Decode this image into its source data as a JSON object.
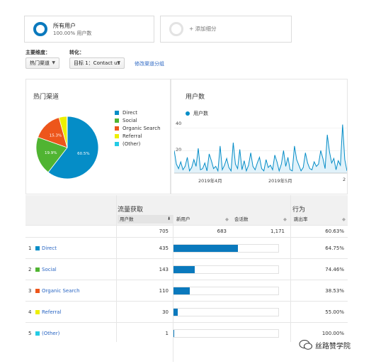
{
  "segments": {
    "active": {
      "title": "所有用户",
      "subtitle": "100.00% 用户数"
    },
    "add": {
      "label": "+ 添加细分"
    }
  },
  "controls": {
    "primary_label": "主要维度：",
    "conversion_label": "转化：",
    "primary_value": "热门渠道",
    "conversion_value": "目标 1：Contact us",
    "edit_link": "修改渠道分组"
  },
  "pie_panel": {
    "title": "热门渠道",
    "legend": [
      {
        "name": "Direct",
        "color": "#058dc7"
      },
      {
        "name": "Social",
        "color": "#50b432"
      },
      {
        "name": "Organic Search",
        "color": "#ed561b"
      },
      {
        "name": "Referral",
        "color": "#edef00"
      },
      {
        "name": "(Other)",
        "color": "#24cbe5"
      }
    ]
  },
  "line_panel": {
    "title": "用户数",
    "legend": "用户数",
    "y_ticks": [
      "40",
      "20"
    ],
    "x_ticks": [
      "2019年4月",
      "2019年5月",
      "2"
    ]
  },
  "chart_data": [
    {
      "type": "pie",
      "categories": [
        "Direct",
        "Social",
        "Organic Search",
        "Referral",
        "(Other)"
      ],
      "values": [
        435,
        143,
        110,
        30,
        1
      ],
      "labels": [
        "60.5%",
        "19.9%",
        "15.3%",
        "",
        ""
      ]
    },
    {
      "type": "area",
      "series": [
        {
          "name": "用户数",
          "values": [
            20,
            8,
            4,
            10,
            3,
            6,
            14,
            2,
            5,
            12,
            6,
            22,
            3,
            4,
            9,
            2,
            17,
            11,
            4,
            6,
            2,
            24,
            3,
            7,
            13,
            5,
            2,
            27,
            8,
            4,
            21,
            3,
            11,
            2,
            7,
            18,
            6,
            3,
            9,
            14,
            4,
            2,
            12,
            5,
            7,
            3,
            16,
            10,
            2,
            8,
            20,
            6,
            14,
            3,
            2,
            24,
            12,
            7,
            2,
            5,
            18,
            9,
            4,
            3,
            10,
            6,
            8,
            20,
            13,
            4,
            34,
            19,
            9,
            13,
            3,
            11,
            7,
            43,
            12,
            2
          ]
        }
      ],
      "ylim": [
        0,
        40
      ]
    }
  ],
  "table": {
    "group_acquisition": "流量获取",
    "group_behavior": "行为",
    "columns": [
      "用户数",
      "新用户",
      "会话数",
      "跳出率"
    ],
    "totals": [
      "705",
      "683",
      "1,171",
      "60.63%"
    ],
    "rows": [
      {
        "idx": "1",
        "name": "Direct",
        "color": "#058dc7",
        "users": "435",
        "bounce": "64.75%",
        "share": 0.617
      },
      {
        "idx": "2",
        "name": "Social",
        "color": "#50b432",
        "users": "143",
        "bounce": "74.46%",
        "share": 0.203
      },
      {
        "idx": "3",
        "name": "Organic Search",
        "color": "#ed561b",
        "users": "110",
        "bounce": "38.53%",
        "share": 0.156
      },
      {
        "idx": "4",
        "name": "Referral",
        "color": "#edef00",
        "users": "30",
        "bounce": "55.00%",
        "share": 0.043
      },
      {
        "idx": "5",
        "name": "(Other)",
        "color": "#24cbe5",
        "users": "1",
        "bounce": "100.00%",
        "share": 0.0014
      }
    ]
  },
  "watermark": {
    "text": "丝路赞学院"
  }
}
